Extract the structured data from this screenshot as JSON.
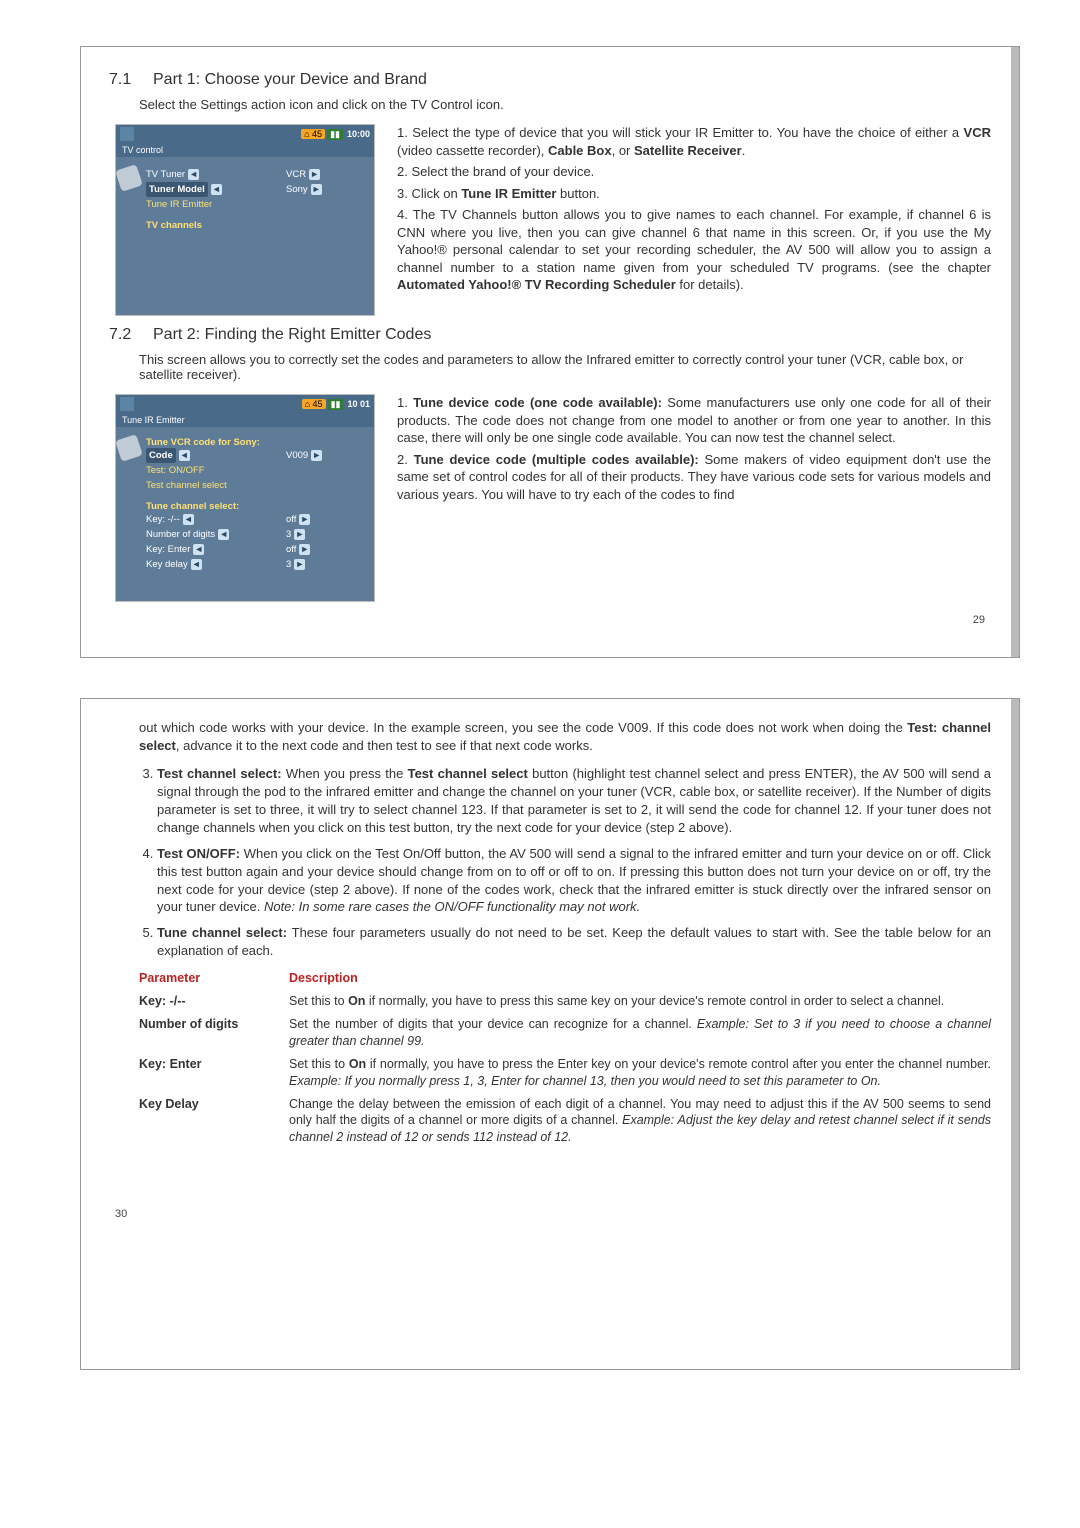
{
  "page29": {
    "bignum": "29",
    "footer": "29",
    "sec71": {
      "num": "7.1",
      "title": "Part 1: Choose your Device and Brand",
      "intro": "Select the Settings action icon and click on the TV Control icon."
    },
    "shot1": {
      "battery": "45",
      "time": "10:00",
      "breadcrumb": "TV control",
      "l1l": "TV Tuner",
      "l1r": "VCR",
      "l2l": "Tuner Model",
      "l2r": "Sony",
      "l3l": "Tune IR Emitter",
      "ch": "TV channels"
    },
    "right1": {
      "p1a": "1. Select the type of device that you will stick your IR Emitter to. You have the choice of either a ",
      "p1b": "VCR",
      "p1c": " (video cassette recorder), ",
      "p1d": "Cable Box",
      "p1e": ", or ",
      "p1f": "Satellite Receiver",
      "p1g": ".",
      "p2": "2. Select the brand of your device.",
      "p3a": "3. Click on ",
      "p3b": "Tune IR Emitter",
      "p3c": " button.",
      "p4a": "4. The TV Channels button allows you to give names to each channel. For example, if channel 6 is CNN where you live, then you can give channel 6 that name in this screen. Or, if you use the My Yahoo!® personal calendar to set your recording scheduler, the AV 500 will allow you to assign a channel number to a station name given from your scheduled TV programs. (see the chapter ",
      "p4b": "Automated Yahoo!® TV Recording Scheduler",
      "p4c": " for details)."
    },
    "sec72": {
      "num": "7.2",
      "title": "Part 2: Finding the Right Emitter Codes",
      "intro": "This screen allows you to correctly set the codes and parameters to allow the Infrared emitter to correctly control your tuner (VCR, cable box, or satellite receiver)."
    },
    "shot2": {
      "battery": "45",
      "time": "10 01",
      "breadcrumb": "Tune IR Emitter",
      "grp1": "Tune VCR code for Sony:",
      "g1a": "Code",
      "g1ar": "V009",
      "g1b": "Test: ON/OFF",
      "g1c": "Test channel select",
      "grp2": "Tune channel select:",
      "g2a": "Key: -/--",
      "g2ar": "off",
      "g2b": "Number of digits",
      "g2br": "3",
      "g2c": "Key: Enter",
      "g2cr": "off",
      "g2d": "Key delay",
      "g2dr": "3"
    },
    "right2": {
      "p1a": "1. ",
      "p1b": "Tune device code (one code available):",
      "p1c": " Some manufacturers use only one code for all of their products. The code does not change from one model to another or from one year to another. In this case, there will only be one single code available. You can now test the channel select.",
      "p2a": "2. ",
      "p2b": "Tune device code (multiple codes available):",
      "p2c": " Some makers of video equipment don't use the same set of control codes for all of their products. They have various code sets for various models and various years. You will have to try each of the codes to find"
    }
  },
  "page30": {
    "bignum": "30",
    "footer": "30",
    "cont1a": "out which code works with your device. In the example screen, you see the code V009. If this code does not work when doing the ",
    "cont1b": "Test: channel select",
    "cont1c": ", advance it to the next code and then test to see if that next code works.",
    "li3a": "Test channel select:",
    "li3b": " When you press the ",
    "li3c": "Test channel select",
    "li3d": " button (highlight test channel select and press ENTER), the AV 500 will send a signal through the pod to the infrared emitter and change the channel on your tuner (VCR, cable box, or satellite receiver). If the Number of digits parameter is set to three, it will try to select channel 123. If that parameter is set to 2, it will send the code for channel 12. If your tuner does not change channels when you click on this test button, try the next code for your device (step 2 above).",
    "li4a": "Test ON/OFF:",
    "li4b": " When you click on the Test On/Off button, the AV 500 will send a signal to the infrared emitter and turn your device on or off. Click this test button again and your device should change from on to off or off to on. If pressing this button does not turn your device on or off, try the next code for your device (step 2 above). If none of the codes work, check that the infrared emitter is stuck directly over the infrared sensor on your tuner device. ",
    "li4c": "Note: In some rare cases the ON/OFF functionality may not work.",
    "li5a": "Tune channel select:",
    "li5b": " These four parameters usually do not need to be set. Keep the default values to start with. See the table below for an explanation of each.",
    "tbl": {
      "h1": "Parameter",
      "h2": "Description",
      "r1p": "Key: -/--",
      "r1d": "Set this to ",
      "r1d2": "On",
      "r1d3": " if normally, you have to press this same key on your device's remote control in order to select a channel.",
      "r2p": "Number of digits",
      "r2d": "Set the number of digits that your device can recognize for a channel. ",
      "r2d2": "Example: Set to 3 if you need to choose a channel greater than channel 99.",
      "r3p": "Key: Enter",
      "r3d": "Set this to ",
      "r3d2": "On",
      "r3d3": " if normally, you have to press the Enter key on your device's remote control after you enter the channel number. ",
      "r3d4": "Example: If you normally press 1, 3, Enter for channel 13, then you would need to set this parameter to On.",
      "r4p": "Key Delay",
      "r4d": "Change the delay between the emission of each digit of a channel. You may need to adjust this if the AV 500 seems to send only half the digits of a channel or more digits of a channel. ",
      "r4d2": "Example: Adjust the key delay and retest channel select if it sends channel 2 instead of 12 or sends 112 instead of 12."
    }
  }
}
